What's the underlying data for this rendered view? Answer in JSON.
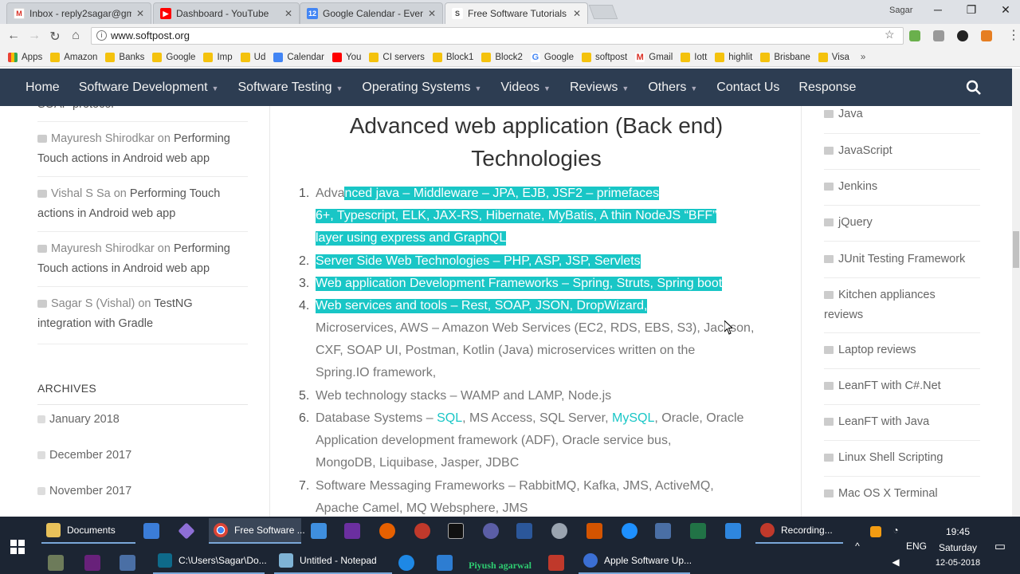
{
  "browser": {
    "tabs": [
      {
        "title": "Inbox - reply2sagar@gm",
        "favicon": "gmail-icon",
        "color": "#d93025"
      },
      {
        "title": "Dashboard - YouTube",
        "favicon": "youtube-icon",
        "color": "#ff0000"
      },
      {
        "title": "Google Calendar - Event",
        "favicon": "calendar-icon",
        "color": "#4285f4"
      },
      {
        "title": "Free Software Tutorials -",
        "favicon": "softpost-icon",
        "color": "#555555"
      }
    ],
    "user": "Sagar",
    "url": "www.softpost.org"
  },
  "bookmarks": [
    {
      "label": "Apps",
      "icon": "apps-grid-icon"
    },
    {
      "label": "Amazon",
      "icon": "folder-icon"
    },
    {
      "label": "Banks",
      "icon": "folder-icon"
    },
    {
      "label": "Google",
      "icon": "folder-icon"
    },
    {
      "label": "Imp",
      "icon": "folder-icon"
    },
    {
      "label": "Ud",
      "icon": "folder-icon"
    },
    {
      "label": "Calendar",
      "icon": "calendar-icon"
    },
    {
      "label": "You",
      "icon": "youtube-icon"
    },
    {
      "label": "CI servers",
      "icon": "folder-icon"
    },
    {
      "label": "Block1",
      "icon": "folder-icon"
    },
    {
      "label": "Block2",
      "icon": "folder-icon"
    },
    {
      "label": "Google",
      "icon": "google-icon"
    },
    {
      "label": "softpost",
      "icon": "folder-icon"
    },
    {
      "label": "Gmail",
      "icon": "gmail-icon"
    },
    {
      "label": "Iott",
      "icon": "folder-icon"
    },
    {
      "label": "highlit",
      "icon": "folder-icon"
    },
    {
      "label": "Brisbane",
      "icon": "folder-icon"
    },
    {
      "label": "Visa",
      "icon": "folder-icon"
    }
  ],
  "nav": {
    "home": "Home",
    "software_development": "Software Development",
    "software_testing": "Software Testing",
    "operating_systems": "Operating Systems",
    "videos": "Videos",
    "reviews": "Reviews",
    "others": "Others",
    "contact": "Contact Us",
    "response": "Response"
  },
  "sidebar": {
    "partial_top": "SOAP protocol",
    "comments": [
      {
        "author": "Mayuresh Shirodkar",
        "on": "on",
        "post_line1": "Performing",
        "post_line2": "Touch actions in Android web app"
      },
      {
        "author": "Vishal S Sa",
        "on": "on",
        "post_line1": "Performing Touch",
        "post_line2": "actions in Android web app"
      },
      {
        "author": "Mayuresh Shirodkar",
        "on": "on",
        "post_line1": "Performing",
        "post_line2": "Touch actions in Android web app"
      },
      {
        "author": "Sagar S (Vishal)",
        "on": "on",
        "post_line1": "TestNG",
        "post_line2": "integration with Gradle"
      }
    ],
    "archives_title": "ARCHIVES",
    "archives": [
      "January 2018",
      "December 2017",
      "November 2017"
    ]
  },
  "article": {
    "title_line1": "Advanced web application (Back end)",
    "title_line2": "Technologies",
    "items": {
      "i1": {
        "num": "1.",
        "a": "Adva",
        "b": "nced java – Middleware – JPA, EJB, JSF2 – primefaces ",
        "c": "6+, Typescript, ELK, JAX-RS, Hibernate, MyBatis, A thin NodeJS “BFF” ",
        "d": "layer using express and GraphQL "
      },
      "i2": {
        "num": "2.",
        "a": "Server Side Web Technologies –  PHP, ASP, JSP, Servlets "
      },
      "i3": {
        "num": "3.",
        "a": "Web application Development Frameworks – Spring, Struts, Spring boot "
      },
      "i4": {
        "num": "4.",
        "a": "Web services and tools – Rest, SOAP, JSON, DropWizard,",
        "b": "Microservices, AWS – Amazon Web Services (EC2, RDS, EBS, S3), Jackson,",
        "c": "CXF, SOAP UI, Postman, Kotlin (Java) microservices written on the",
        "d": "Spring.IO framework,"
      },
      "i5": {
        "num": "5.",
        "a": "Web technology stacks – WAMP and LAMP, Node.js"
      },
      "i6": {
        "num": "6.",
        "a": "Database Systems – ",
        "sql": "SQL",
        "b": ", MS Access, SQL Server, ",
        "mysql": "MySQL",
        "c": ", Oracle, Oracle",
        "d": "Application development framework (ADF), Oracle service bus,",
        "e": "MongoDB, Liquibase, Jasper, JDBC"
      },
      "i7": {
        "num": "7.",
        "a": "Software Messaging Frameworks – RabbitMQ, Kafka, JMS, ActiveMQ,",
        "b": "Apache Camel,  MQ Websphere, JMS"
      }
    }
  },
  "categories": [
    "Java",
    "JavaScript",
    "Jenkins",
    "jQuery",
    "JUnit Testing Framework",
    "Kitchen appliances",
    "reviews",
    "Laptop reviews",
    "LeanFT with C#.Net",
    "LeanFT with Java",
    "Linux Shell Scripting",
    "Mac OS X Terminal"
  ],
  "taskbar": {
    "documents": "Documents",
    "chrome": "Free Software ...",
    "recording": "Recording...",
    "cmd": "C:\\Users\\Sagar\\Do...",
    "notepad": "Untitled - Notepad",
    "apple": "Apple Software Up...",
    "overlay_name": "Piyush agarwal",
    "lang": "ENG",
    "time": "19:45",
    "day": "Saturday",
    "date": "12-05-2018"
  },
  "colors": {
    "accent": "#19c6c6",
    "nav_bg": "#2d3d52",
    "taskbar_bg": "#1c2533"
  }
}
